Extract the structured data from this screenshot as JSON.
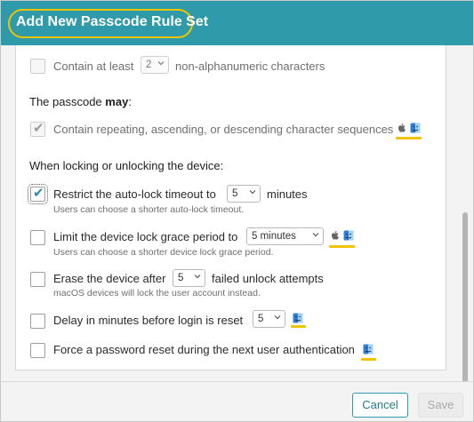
{
  "dialog": {
    "title": "Add New Passcode Rule Set"
  },
  "rules": {
    "alphanumeric": {
      "prefix": "Contain at least",
      "value": "2",
      "suffix": "non-alphanumeric characters",
      "checked": false
    },
    "may_heading_prefix": "The passcode ",
    "may_heading_bold": "may",
    "may_heading_suffix": ":",
    "sequences": {
      "label": "Contain repeating, ascending, or descending character sequences",
      "checked": true,
      "icons": [
        "apple-icon",
        "finder-icon"
      ]
    },
    "lock_heading": "When locking or unlocking the device:",
    "autolock": {
      "label": "Restrict the auto-lock timeout to",
      "value": "5",
      "suffix": "minutes",
      "help": "Users can choose a shorter auto-lock timeout.",
      "checked": true
    },
    "grace": {
      "label": "Limit the device lock grace period to",
      "value": "5 minutes",
      "help": "Users can choose a shorter device lock grace period.",
      "checked": false,
      "icons": [
        "apple-icon",
        "finder-icon"
      ]
    },
    "erase": {
      "label": "Erase the device after",
      "value": "5",
      "suffix": "failed unlock attempts",
      "help": "macOS devices will lock the user account instead.",
      "checked": false
    },
    "delay": {
      "label": "Delay in minutes before login is reset",
      "value": "5",
      "checked": false,
      "icons": [
        "finder-icon"
      ]
    },
    "force_reset": {
      "label": "Force a password reset during the next user authentication",
      "checked": false,
      "icons": [
        "finder-icon"
      ]
    }
  },
  "footer": {
    "cancel_label": "Cancel",
    "save_label": "Save"
  },
  "colors": {
    "header": "#2f9aa9",
    "highlight": "#f2c400",
    "accent_text": "#1f7f8e"
  }
}
